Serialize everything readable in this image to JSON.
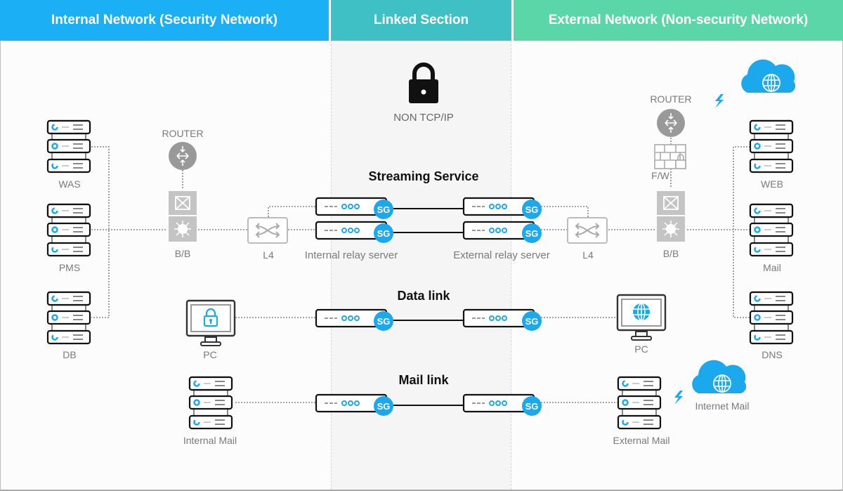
{
  "headers": {
    "internal": "Internal Network (Security Network)",
    "linked": "Linked Section",
    "external": "External Network (Non-security Network)"
  },
  "colors": {
    "internal": "#1bb0f5",
    "linked": "#3ec0c4",
    "external": "#5ad6a8",
    "accent": "#1ba8ec",
    "device_gray": "#bdbdbd"
  },
  "linked_section": {
    "protocol_label": "NON TCP/IP",
    "streaming_title": "Streaming Service",
    "data_title": "Data link",
    "mail_title": "Mail link",
    "internal_relay_label": "Internal relay server",
    "external_relay_label": "External relay server",
    "sg_badge": "SG"
  },
  "internal": {
    "servers": [
      "WAS",
      "PMS",
      "DB"
    ],
    "router_label": "ROUTER",
    "backbone_label": "B/B",
    "l4_label": "L4",
    "pc_label": "PC",
    "mail_label": "Internal Mail"
  },
  "external": {
    "servers": [
      "WEB",
      "Mail",
      "DNS"
    ],
    "router_label": "ROUTER",
    "firewall_label": "F/W",
    "backbone_label": "B/B",
    "l4_label": "L4",
    "pc_label": "PC",
    "mail_label": "External Mail",
    "internet_mail_label": "Internet Mail"
  }
}
